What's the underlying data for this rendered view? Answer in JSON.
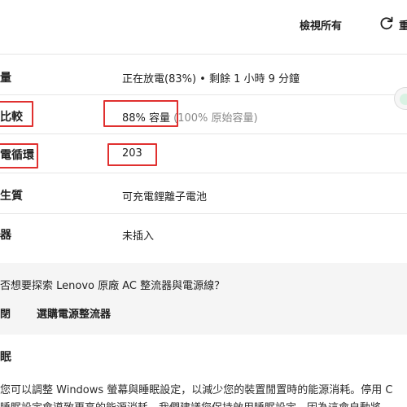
{
  "header": {
    "view_all": "檢視所有",
    "refresh_label": "重"
  },
  "rows": [
    {
      "label": "量",
      "value": "正在放電(83%) • 剩餘 1 小時 9 分鐘"
    },
    {
      "label": "比較",
      "value": "88% 容量",
      "value_muted": "(100% 原始容量)"
    },
    {
      "label": "電循環",
      "value": "203"
    },
    {
      "label": "生質",
      "value": "可充電鋰離子電池"
    },
    {
      "label": "器",
      "value": "未插入"
    }
  ],
  "promo": {
    "question": "否想要探索 Lenovo 原廠 AC 整流器與電源線？",
    "close_label": "閉",
    "buy_label": "選購電源整流器"
  },
  "sleep": {
    "title": "眠",
    "line1": "您可以調整 Windows 螢幕與睡眠設定，以減少您的裝置閒置時的能源消耗。停用 C",
    "line2": "睡眠設定會導致更高的能源消耗。我們建議您保持啟用睡眠設定，因為這會自動將"
  },
  "colors": {
    "highlight": "#e0302f",
    "promo_background": "#f5f5f5"
  }
}
